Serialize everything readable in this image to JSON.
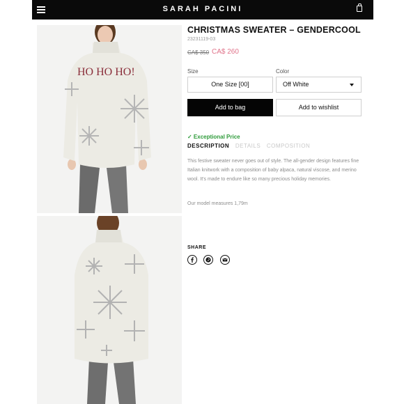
{
  "header": {
    "brand": "SARAH PACINI",
    "menu_icon": "hamburger-menu-icon",
    "bag_icon": "shopping-bag-icon",
    "background": "#0a0a0a"
  },
  "gallery": {
    "images": [
      {
        "name": "front view",
        "text": "HO HO HO!"
      },
      {
        "name": "back view"
      }
    ]
  },
  "product": {
    "title": "CHRISTMAS SWEATER – GENDERCOOL",
    "sku": "23231119-03",
    "price_original": "CA$ 350",
    "price_sale": "CA$ 260",
    "sale_color": "#e0738a"
  },
  "options": {
    "size_label": "Size",
    "size_value": "One Size [00]",
    "color_label": "Color",
    "color_value": "Off White"
  },
  "actions": {
    "add_to_bag": "Add to bag",
    "add_to_wishlist": "Add to wishlist"
  },
  "badge": {
    "exceptional": "✓ Exceptional Price",
    "color": "#2e9b3a"
  },
  "tabs": [
    {
      "label": "DESCRIPTION",
      "active": true
    },
    {
      "label": "DETAILS",
      "active": false
    },
    {
      "label": "COMPOSITION",
      "active": false
    }
  ],
  "description": {
    "text": "This festive sweater never goes out of style. The all-gender design features fine Italian knitwork with a composition of baby alpaca, natural viscose, and merino wool. It's made to endure like so many precious holiday memories.",
    "model": "Our model measures 1,79m"
  },
  "share": {
    "label": "SHARE",
    "icons": [
      "facebook-icon",
      "pinterest-icon",
      "email-icon"
    ]
  }
}
